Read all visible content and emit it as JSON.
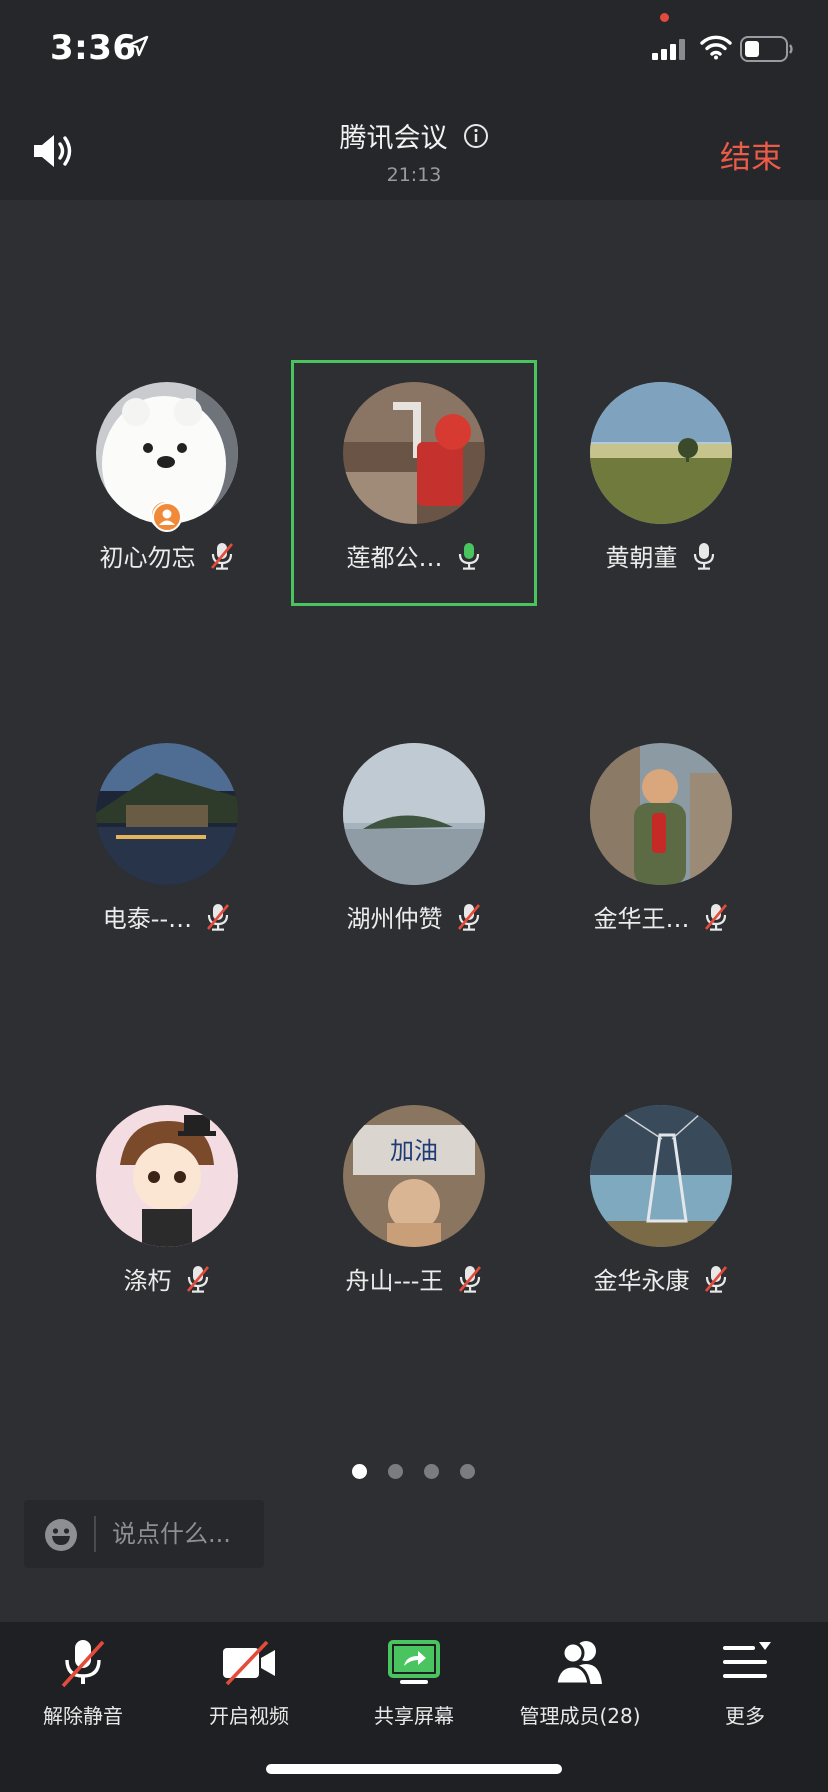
{
  "status_bar": {
    "time": "3:36"
  },
  "header": {
    "title": "腾讯会议",
    "duration": "21:13",
    "end_label": "结束"
  },
  "participants": [
    {
      "name": "初心勿忘",
      "mic": "muted",
      "host": true
    },
    {
      "name": "莲都公…",
      "mic": "speaking",
      "active": true
    },
    {
      "name": "黄朝董",
      "mic": "on"
    },
    {
      "name": "电泰--…",
      "mic": "muted"
    },
    {
      "name": "湖州仲赞",
      "mic": "muted"
    },
    {
      "name": "金华王…",
      "mic": "muted"
    },
    {
      "name": "涤朽",
      "mic": "muted"
    },
    {
      "name": "舟山---王",
      "mic": "muted"
    },
    {
      "name": "金华永康",
      "mic": "muted"
    }
  ],
  "avatar_9_text": "加油",
  "pagination": {
    "total": 4,
    "current": 1
  },
  "chat": {
    "placeholder": "说点什么..."
  },
  "toolbar": {
    "unmute_label": "解除静音",
    "video_label": "开启视频",
    "share_label": "共享屏幕",
    "members_label": "管理成员(28)",
    "more_label": "更多"
  },
  "colors": {
    "accent_green": "#49c45f",
    "end_red": "#ec5a48",
    "background": "#2e2f32"
  }
}
